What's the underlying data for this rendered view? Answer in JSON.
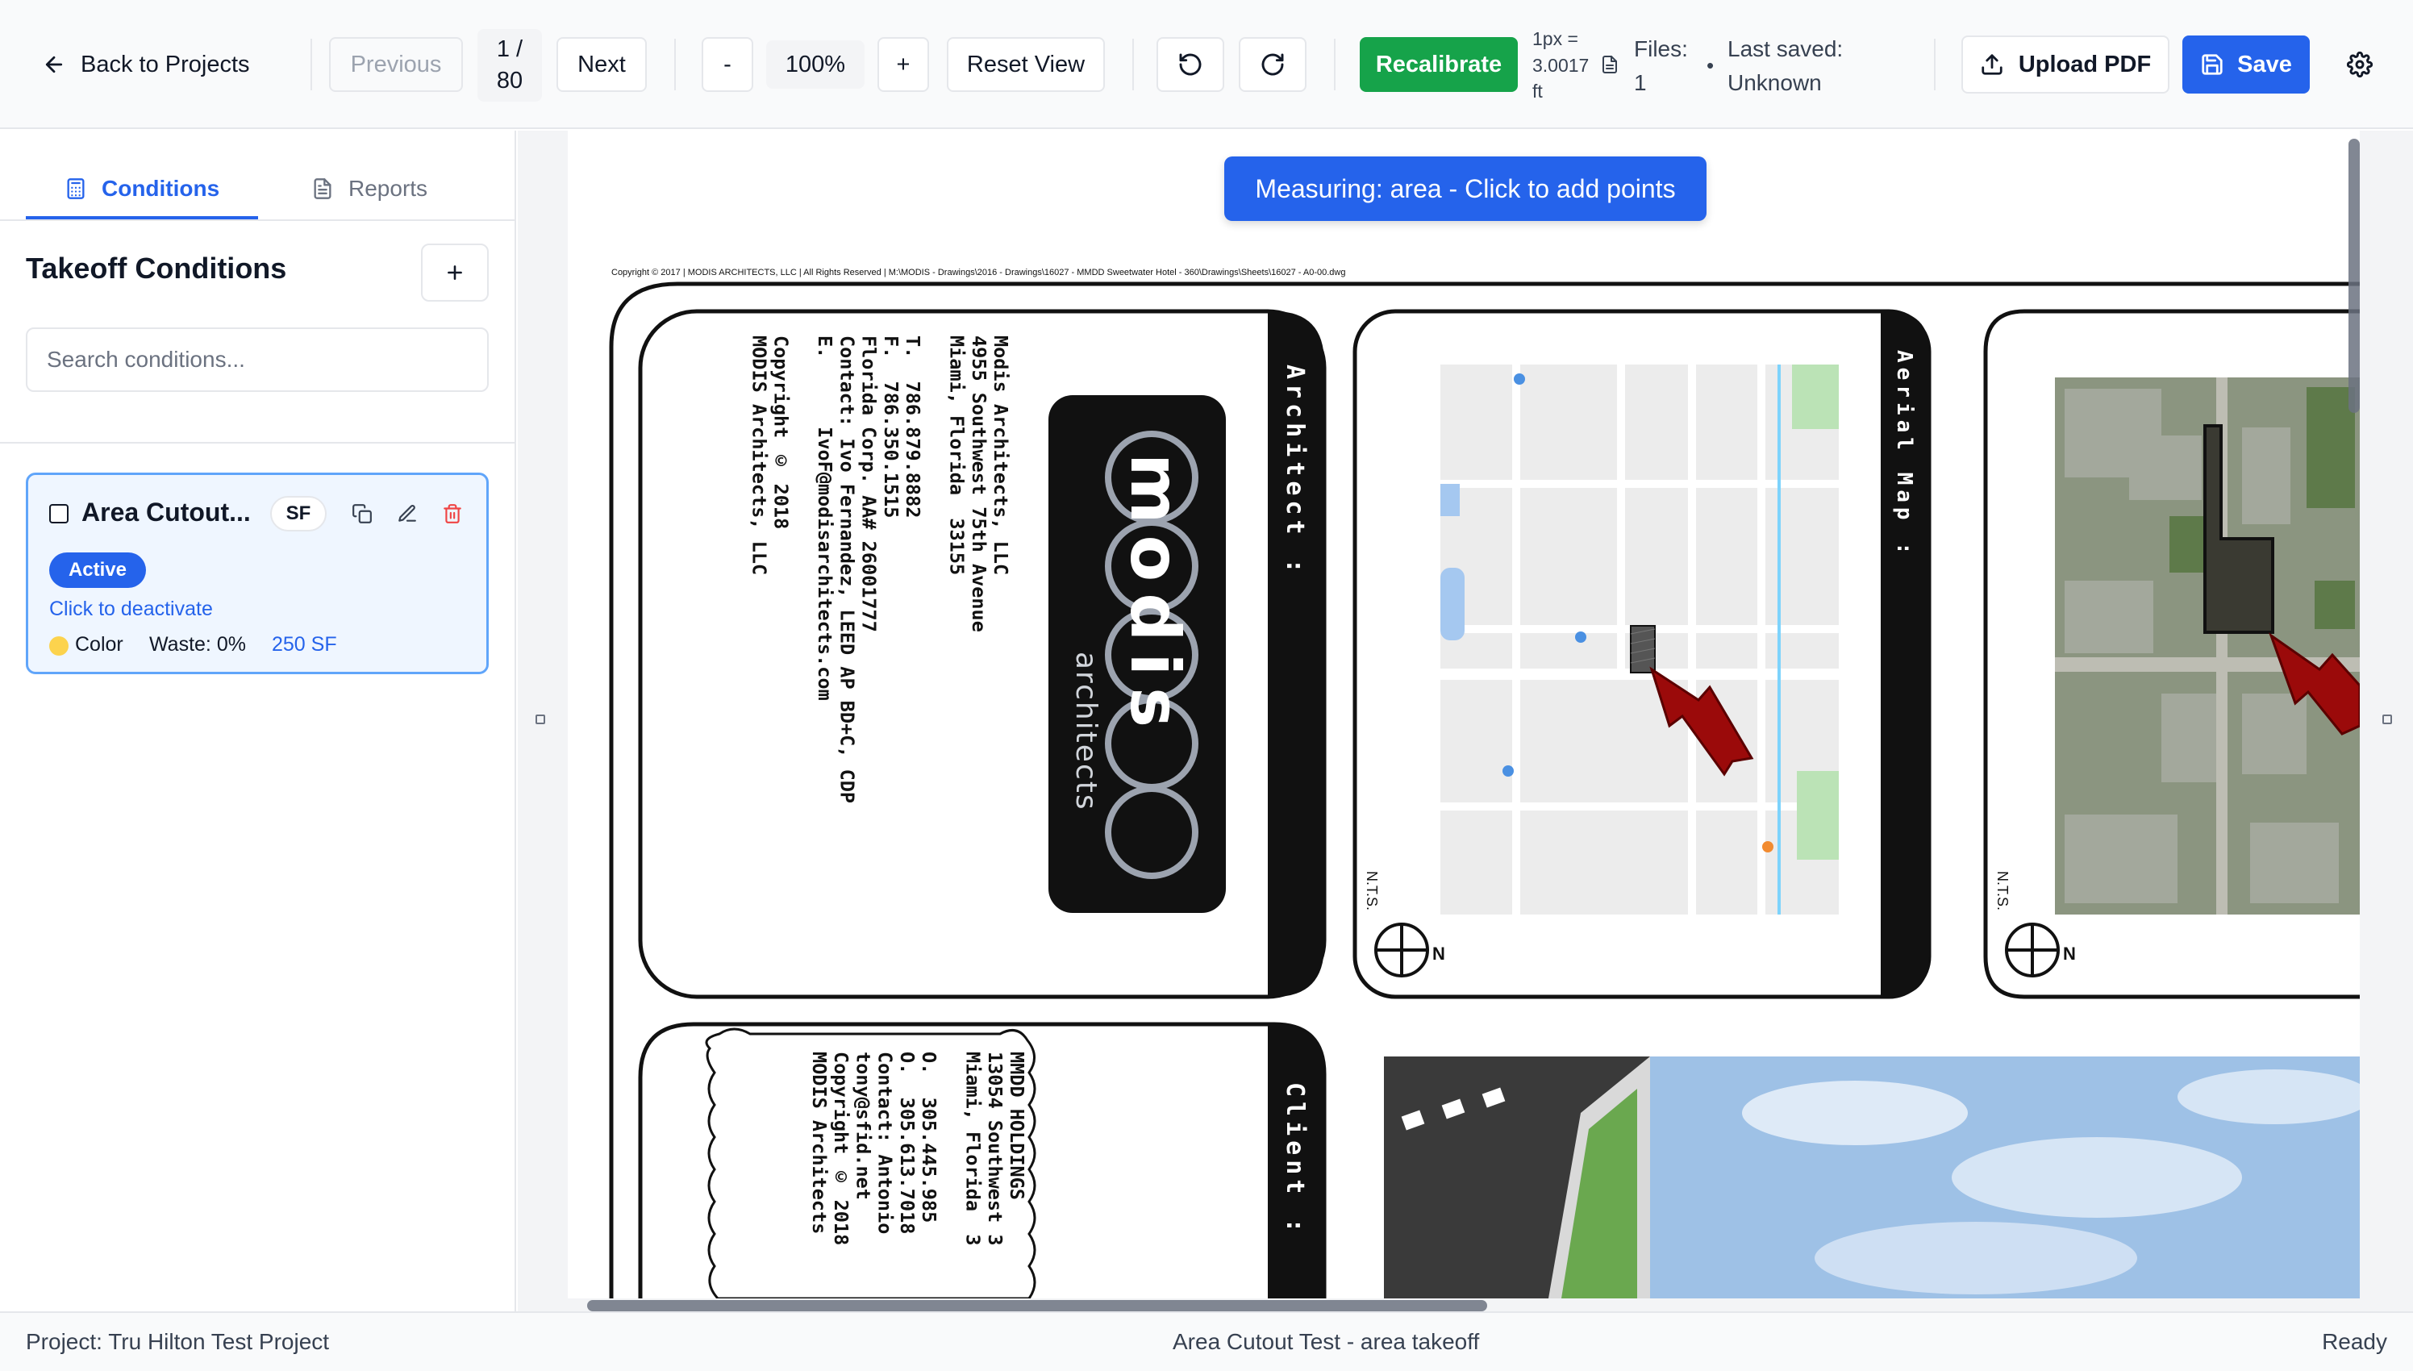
{
  "toolbar": {
    "back_label": "Back to Projects",
    "previous_label": "Previous",
    "page_current": "1 /",
    "page_total": "80",
    "next_label": "Next",
    "zoom_out_label": "-",
    "zoom_level": "100%",
    "zoom_in_label": "+",
    "reset_view_label": "Reset View",
    "recalibrate_label": "Recalibrate",
    "scale_line1": "1px =",
    "scale_line2": "3.0017",
    "scale_line3": "ft",
    "files_line1": "Files:",
    "files_line2": "1",
    "bullet": "•",
    "saved_line1": "Last saved:",
    "saved_line2": "Unknown",
    "upload_label": "Upload PDF",
    "save_label": "Save"
  },
  "sidebar": {
    "tabs": [
      {
        "label": "Conditions",
        "active": true,
        "icon": "calculator-icon"
      },
      {
        "label": "Reports",
        "active": false,
        "icon": "report-icon"
      }
    ],
    "title": "Takeoff Conditions",
    "add_label": "+",
    "search_placeholder": "Search conditions...",
    "conditions": [
      {
        "name": "Area Cutout...",
        "unit": "SF",
        "status": "Active",
        "toggle_hint": "Click to deactivate",
        "color_label": "Color",
        "color": "#fcd34d",
        "waste": "Waste: 0%",
        "total": "250 SF"
      }
    ]
  },
  "canvas": {
    "banner": "Measuring: area - Click to add points",
    "copyright_line": "Copyright © 2017  |  MODIS ARCHITECTS, LLC  |  All Rights Reserved  |  M:\\MODIS - Drawings\\2016 - Drawings\\16027 - MMDD Sweetwater Hotel - 360\\Drawings\\Sheets\\16027 - A0-00.dwg",
    "architect_header": "Architect :",
    "aerial_header": "Aerial Map :",
    "client_header": "Client :",
    "logo_text": "modis",
    "logo_sub": "architects",
    "architect_block": "Modis Architects, LLC\n4955 Southwest 75th Avenue\nMiami, Florida  33155\n\nT.  786.879.8882\nF.  786.350.1515\nFlorida Corp. AA# 26001777\nContact: Ivo Fernandez, LEED AP BD+C, CDP\nE.      IvoF@modisarchitects.com\n\nCopyright © 2018\nMODIS Architects, LLC",
    "client_block": "MMDD HOLDINGS\n13054 Southwest 3\nMiami, Florida  3\n\nO.  305.445.985\nO.  305.613.7018\nContact: Antonio\ntony@sfid.net\nCopyright © 2018\nMODIS Architects",
    "nts_label": "N.T.S.",
    "north_label": "N"
  },
  "status": {
    "project": "Project: Tru Hilton Test Project",
    "mode": "Area Cutout Test - area takeoff",
    "state": "Ready"
  },
  "colors": {
    "accent": "#2563eb",
    "recalibrate": "#16a34a",
    "arrow_red": "#9b0a0a"
  }
}
